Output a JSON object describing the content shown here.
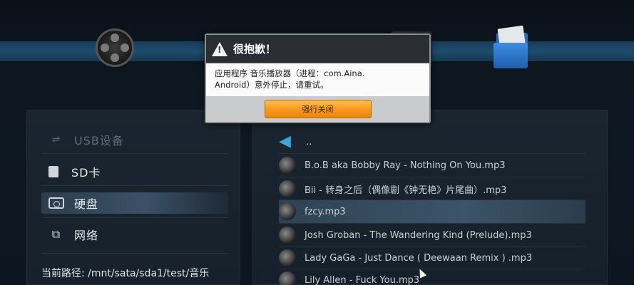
{
  "dialog": {
    "title": "很抱歉！",
    "message_line1": "应用程序 音乐播放器（进程：com.Aina.",
    "message_line2": "Android）意外停止，请重试。",
    "force_close_label": "强行关闭",
    "warning_symbol": "!"
  },
  "sidebar": {
    "items": [
      {
        "label": "USB设备",
        "icon": "usb-icon"
      },
      {
        "label": "SD卡",
        "icon": "sd-card-icon"
      },
      {
        "label": "硬盘",
        "icon": "hard-disk-icon"
      },
      {
        "label": "网络",
        "icon": "network-icon"
      }
    ],
    "current_path": "当前路径: /mnt/sata/sda1/test/音乐"
  },
  "files": {
    "parent_label": "..",
    "items": [
      "B.o.B aka Bobby Ray - Nothing On You.mp3",
      "Bii - 转身之后（偶像剧《钟无艳》片尾曲）.mp3",
      "fzcy.mp3",
      "Josh Groban - The Wandering Kind (Prelude).mp3",
      "Lady GaGa - Just Dance ( Deewaan Remix ) .mp3",
      "Lily Allen - Fuck You.mp3"
    ]
  },
  "colors": {
    "accent_orange": "#f79a1e",
    "selection": "#3b5166",
    "back_arrow": "#3aa6d8"
  }
}
